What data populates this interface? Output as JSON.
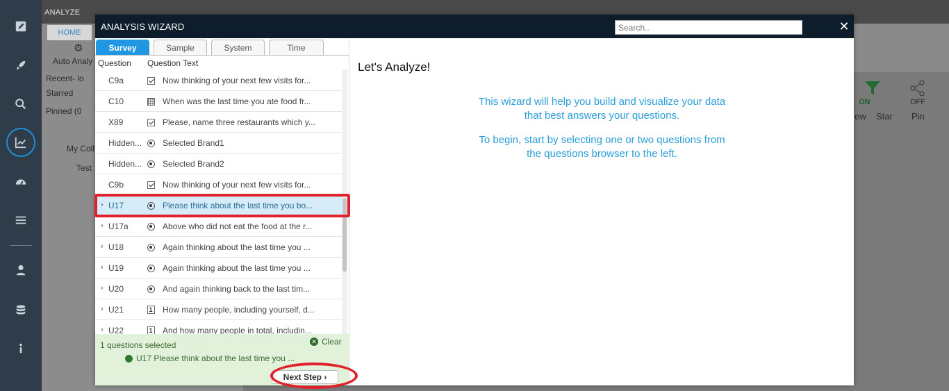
{
  "background": {
    "section_title": "ANALYZE",
    "tab_home": "HOME",
    "auto_analyze": "Auto Analy",
    "recent": "Recent- lo",
    "starred": "Starred",
    "pinned": "Pinned (0",
    "my_collection": "My Coll",
    "test_item": "Test",
    "filter_on": "ON",
    "share_off": "OFF",
    "view_label": "ew",
    "star_label": "Star",
    "pin_label": "Pin"
  },
  "dialog": {
    "title": "ANALYSIS WIZARD",
    "search_placeholder": "Search..",
    "close": "✕",
    "tabs": [
      "Survey",
      "Sample",
      "System",
      "Time"
    ],
    "active_tab": "Survey",
    "columns": {
      "question": "Question",
      "question_text": "Question Text"
    },
    "rows": [
      {
        "chev": "",
        "id": "C9a",
        "icon": "checkbox",
        "text": "Now thinking of your next few visits for..."
      },
      {
        "chev": "",
        "id": "C10",
        "icon": "grid",
        "text": "When was the last time you ate food fr..."
      },
      {
        "chev": "",
        "id": "X89",
        "icon": "checkbox",
        "text": "Please, name three restaurants which y..."
      },
      {
        "chev": "",
        "id": "Hidden...",
        "icon": "radio",
        "text": "Selected Brand1"
      },
      {
        "chev": "",
        "id": "Hidden...",
        "icon": "radio",
        "text": "Selected Brand2"
      },
      {
        "chev": "",
        "id": "C9b",
        "icon": "checkbox",
        "text": "Now thinking of your next few visits for..."
      },
      {
        "chev": "›",
        "id": "U17",
        "icon": "radio",
        "text": "Please think about the last time you bo...",
        "selected": true
      },
      {
        "chev": "›",
        "id": "U17a",
        "icon": "radio",
        "text": "Above who did not eat the food at the r..."
      },
      {
        "chev": "›",
        "id": "U18",
        "icon": "radio",
        "text": "Again thinking about the last time you ..."
      },
      {
        "chev": "›",
        "id": "U19",
        "icon": "radio",
        "text": "Again thinking about the last time you ..."
      },
      {
        "chev": "›",
        "id": "U20",
        "icon": "radio",
        "text": "And again thinking back to the last tim..."
      },
      {
        "chev": "›",
        "id": "U21",
        "icon": "number",
        "text": "How many people, including yourself, d..."
      },
      {
        "chev": "›",
        "id": "U22",
        "icon": "number",
        "text": "And how many people in total, includin..."
      }
    ],
    "selection": {
      "count_text": "1 questions selected",
      "clear": "Clear",
      "selected_item": "U17 Please think about the last time you ..."
    },
    "next_step": "Next Step ›",
    "heading": "Let's Analyze!",
    "message1": [
      "This wizard will help you build and visualize your data",
      "that best answers your questions."
    ],
    "message2": [
      "To begin, start by selecting one or two questions from",
      "the questions browser to the left."
    ]
  },
  "colors": {
    "accent": "#2196e3",
    "highlight": "#e0202a",
    "header": "#0d1d2c",
    "message": "#2a9ed8"
  }
}
